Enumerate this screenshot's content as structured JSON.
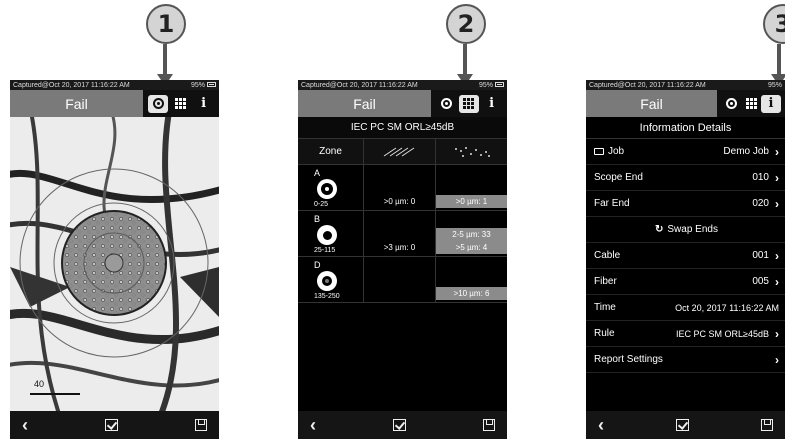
{
  "callouts": [
    "1",
    "2",
    "3"
  ],
  "status": {
    "captured": "Captured@Oct 20, 2017 11:16:22 AM",
    "battery": "95%"
  },
  "result": "Fail",
  "phone1": {
    "scale_label": "40"
  },
  "phone2": {
    "rule": "IEC PC SM ORL≥45dB",
    "zone_header": "Zone",
    "scratch_icon": "scratch-icon",
    "defect_icon": "defect-icon",
    "zones": [
      {
        "letter": "A",
        "range": "0-25",
        "scratches": ">0 µm: 0",
        "defects": [
          ">0 µm: 1"
        ]
      },
      {
        "letter": "B",
        "range": "25-115",
        "scratches": ">3 µm: 0",
        "defects": [
          "2-5 µm: 33",
          ">5 µm: 4"
        ]
      },
      {
        "letter": "D",
        "range": "135-250",
        "scratches": "",
        "defects": [
          ">10 µm: 6"
        ]
      }
    ]
  },
  "phone3": {
    "header": "Information Details",
    "job_label": "Job",
    "job_value": "Demo Job",
    "scope_end_label": "Scope End",
    "scope_end_value": "010",
    "far_end_label": "Far End",
    "far_end_value": "020",
    "swap_label": "Swap Ends",
    "cable_label": "Cable",
    "cable_value": "001",
    "fiber_label": "Fiber",
    "fiber_value": "005",
    "time_label": "Time",
    "time_value": "Oct 20, 2017 11:16:22 AM",
    "rule_label": "Rule",
    "rule_value": "IEC PC SM ORL≥45dB",
    "report_label": "Report Settings"
  },
  "colors": {
    "fail_bg": "#7a7a7a",
    "callout_bg": "#d4d4d4",
    "defect_cell": "#8b8b8b"
  }
}
